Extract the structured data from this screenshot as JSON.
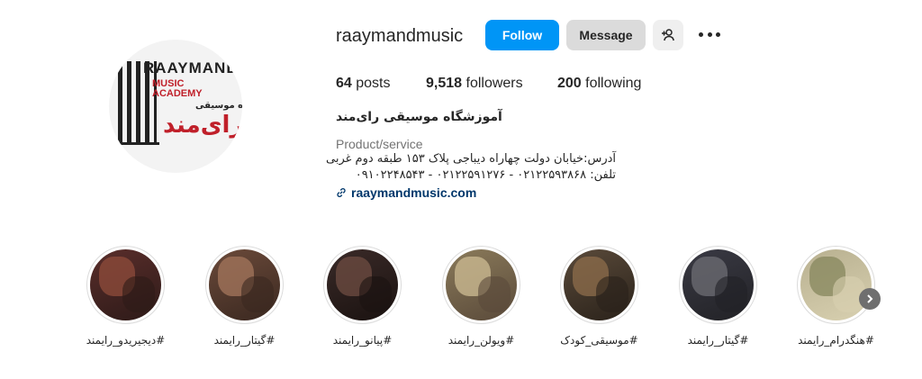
{
  "profile": {
    "username": "raaymandmusic",
    "avatar": {
      "logo_en_1": "RAAYMAND",
      "logo_en_2a": "MUSIC",
      "logo_en_2b": "ACADEMY",
      "logo_fa_small": "آموزشگاه موسیقی",
      "logo_fa_big": "رای‌مند"
    },
    "buttons": {
      "follow": "Follow",
      "message": "Message",
      "adduser_icon": "add-user-icon",
      "more_icon": "more-options-icon"
    },
    "stats": {
      "posts_count": "64",
      "posts_label": "posts",
      "followers_count": "9,518",
      "followers_label": "followers",
      "following_count": "200",
      "following_label": "following"
    },
    "full_name": "آموزشگاه موسیقی رای‌مند",
    "category": "Product/service",
    "bio_lines": [
      "آدرس:خیابان دولت چهاراه دیباجی پلاک ۱۵۳ طبقه دوم غربی",
      "تلفن: ۰۲۱۲۲۵۹۳۸۶۸ - ۰۲۱۲۲۵۹۱۲۷۶ - ۰۹۱۰۲۲۴۸۵۴۳"
    ],
    "link": "raaymandmusic.com",
    "link_icon": "link-icon"
  },
  "highlights": [
    {
      "label": "#دیجیریدو_رایمند",
      "colors": [
        "#5a2e2b",
        "#8b4a3a",
        "#2d1a18"
      ]
    },
    {
      "label": "#گیتار_رایمند",
      "colors": [
        "#6b4a3a",
        "#a0735a",
        "#3a2820"
      ]
    },
    {
      "label": "#پیانو_رایمند",
      "colors": [
        "#3a2a28",
        "#6a4a40",
        "#1a1210"
      ]
    },
    {
      "label": "#ویولن_رایمند",
      "colors": [
        "#8a7a5a",
        "#c9b890",
        "#5a4a3a"
      ]
    },
    {
      "label": "#موسیقی_کودک",
      "colors": [
        "#5a4a3a",
        "#8a6a4a",
        "#2a221a"
      ]
    },
    {
      "label": "#گیتار_رایمند",
      "colors": [
        "#3a3a44",
        "#6a6a70",
        "#222226"
      ]
    },
    {
      "label": "#هنگدرام_رایمند",
      "colors": [
        "#b8b090",
        "#8a8a60",
        "#d8d0b0"
      ]
    }
  ],
  "next_icon": "chevron-right-icon"
}
